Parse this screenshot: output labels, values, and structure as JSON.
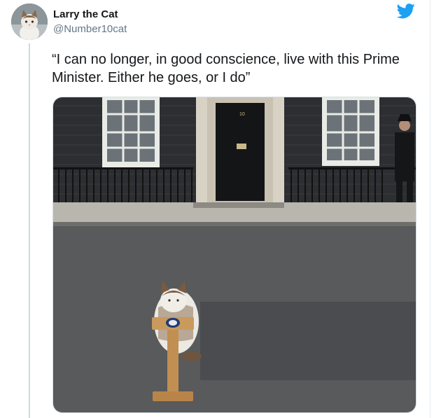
{
  "tweet": {
    "display_name": "Larry the Cat",
    "handle": "@Number10cat",
    "text": "“I can no longer, in good conscience, live with this Prime Minister. Either he goes, or I do”"
  },
  "photo": {
    "door_number": "10"
  },
  "icons": {
    "platform": "twitter-bird-icon",
    "avatar": "cat-avatar"
  },
  "colors": {
    "brand": "#1DA1F2",
    "name_text": "#14171a",
    "handle_text": "#657786"
  }
}
